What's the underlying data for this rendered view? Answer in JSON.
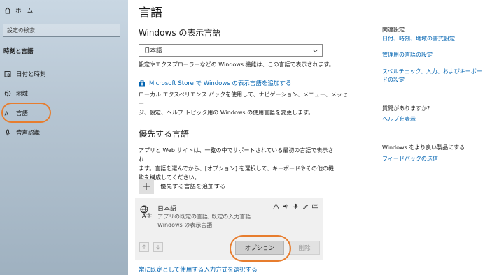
{
  "sidebar": {
    "home_label": "ホーム",
    "search_placeholder": "設定の検索",
    "section_title": "時刻と言語",
    "items": [
      {
        "label": "日付と時刻",
        "icon": "clock-calendar-icon"
      },
      {
        "label": "地域",
        "icon": "globe-icon"
      },
      {
        "label": "言語",
        "icon": "language-icon"
      },
      {
        "label": "音声認識",
        "icon": "microphone-icon"
      }
    ]
  },
  "main": {
    "title": "言語",
    "display_heading": "Windows の表示言語",
    "display_value": "日本語",
    "display_desc": "設定やエクスプローラーなどの Windows 機能は、この言語で表示されます。",
    "store_link": "Microsoft Store で Windows の表示言語を追加する",
    "lx_desc_1": "ローカル エクスペリエンス パックを使用して、ナビゲーション、メニュー、メッセー",
    "lx_desc_2": "ジ、設定、ヘルプ トピック用の Windows の使用言語を変更します。",
    "preferred_heading": "優先する言語",
    "preferred_desc_1": "アプリと Web サイトは、一覧の中でサポートされている最初の言語で表示され",
    "preferred_desc_2": "ます。言語を選んでから、[オプション] を選択して、キーボードやその他の機",
    "preferred_desc_3": "能を構成してください。",
    "add_language": "優先する言語を追加する",
    "language_card": {
      "name": "日本語",
      "sub1": "アプリの既定の言語; 既定の入力言語",
      "sub2": "Windows の表示言語",
      "options_button": "オプション",
      "delete_button": "削除"
    },
    "bottom_link": "常に既定として使用する入力方式を選択する"
  },
  "right": {
    "related_heading": "関連設定",
    "link1": "日付、時刻、地域の書式設定",
    "link2": "管理用の言語の設定",
    "link3": "スペルチェック、入力、およびキーボードの設定",
    "question_heading": "質問がありますか?",
    "help_link": "ヘルプを表示",
    "improve_heading": "Windows をより良い製品にする",
    "feedback_link": "フィードバックの送信"
  },
  "colors": {
    "accent": "#0063b1",
    "highlight_ring": "#e77d2e"
  }
}
